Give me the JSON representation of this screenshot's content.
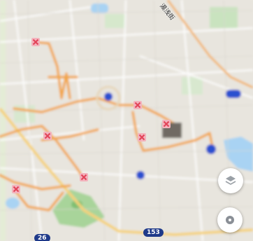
{
  "map": {
    "road_label": "湯浅街",
    "route_shields": [
      "153",
      "26"
    ]
  },
  "controls": {
    "layers_icon": "layers-icon",
    "locate_icon": "compass-icon"
  },
  "colors": {
    "route_line": "#f2a64a",
    "marker_red": "#e2455a",
    "marker_blue": "#2b4fcf",
    "park_green": "#a8d49a",
    "water_blue": "#a9d3f3",
    "highway_yellow": "#f5d27a"
  }
}
